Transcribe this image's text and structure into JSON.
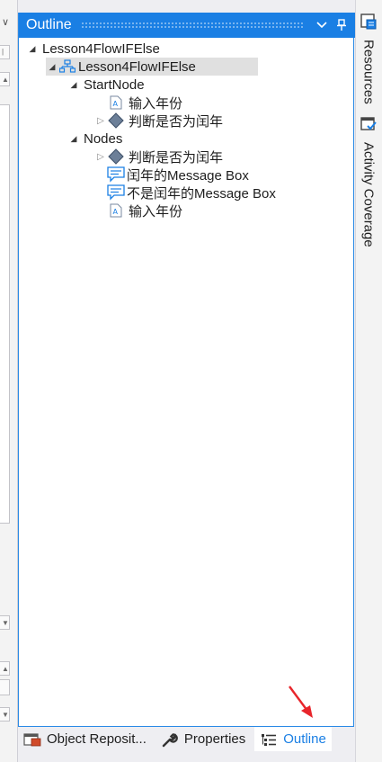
{
  "panel": {
    "title": "Outline",
    "dropdown_icon": "chevron-down-icon",
    "pin_icon": "pin-icon"
  },
  "tree": [
    {
      "label": "Lesson4FlowIFElse",
      "level": 0,
      "expanded": true,
      "icon": "none"
    },
    {
      "label": "Lesson4FlowIFElse",
      "level": 1,
      "expanded": true,
      "icon": "flowchart-icon",
      "selected": true
    },
    {
      "label": "StartNode",
      "level": 2,
      "expanded": true,
      "icon": "none"
    },
    {
      "label": "输入年份",
      "level": 3,
      "expanded": null,
      "icon": "input-dialog-icon"
    },
    {
      "label": "判断是否为闰年",
      "level": 3,
      "expanded": false,
      "icon": "flow-decision-icon"
    },
    {
      "label": "Nodes",
      "level": 2,
      "expanded": true,
      "icon": "none"
    },
    {
      "label": "判断是否为闰年",
      "level": 3,
      "expanded": false,
      "icon": "flow-decision-icon"
    },
    {
      "label": "闰年的Message Box",
      "level": 3,
      "expanded": null,
      "icon": "message-box-icon"
    },
    {
      "label": "不是闰年的Message Box",
      "level": 3,
      "expanded": null,
      "icon": "message-box-icon"
    },
    {
      "label": "输入年份",
      "level": 3,
      "expanded": null,
      "icon": "input-dialog-icon"
    }
  ],
  "bottom_tabs": [
    {
      "label": "Object Reposit...",
      "icon": "object-repository-icon",
      "active": false
    },
    {
      "label": "Properties",
      "icon": "wrench-icon",
      "active": false
    },
    {
      "label": "Outline",
      "icon": "outline-icon",
      "active": true
    }
  ],
  "right_tabs": [
    {
      "label": "Resources",
      "icon": "resources-icon"
    },
    {
      "label": "Activity Coverage",
      "icon": "activity-coverage-icon"
    }
  ],
  "colors": {
    "accent": "#1a7fe4",
    "selected_row": "#e0e0e0",
    "annotation_arrow": "#e8252b"
  }
}
